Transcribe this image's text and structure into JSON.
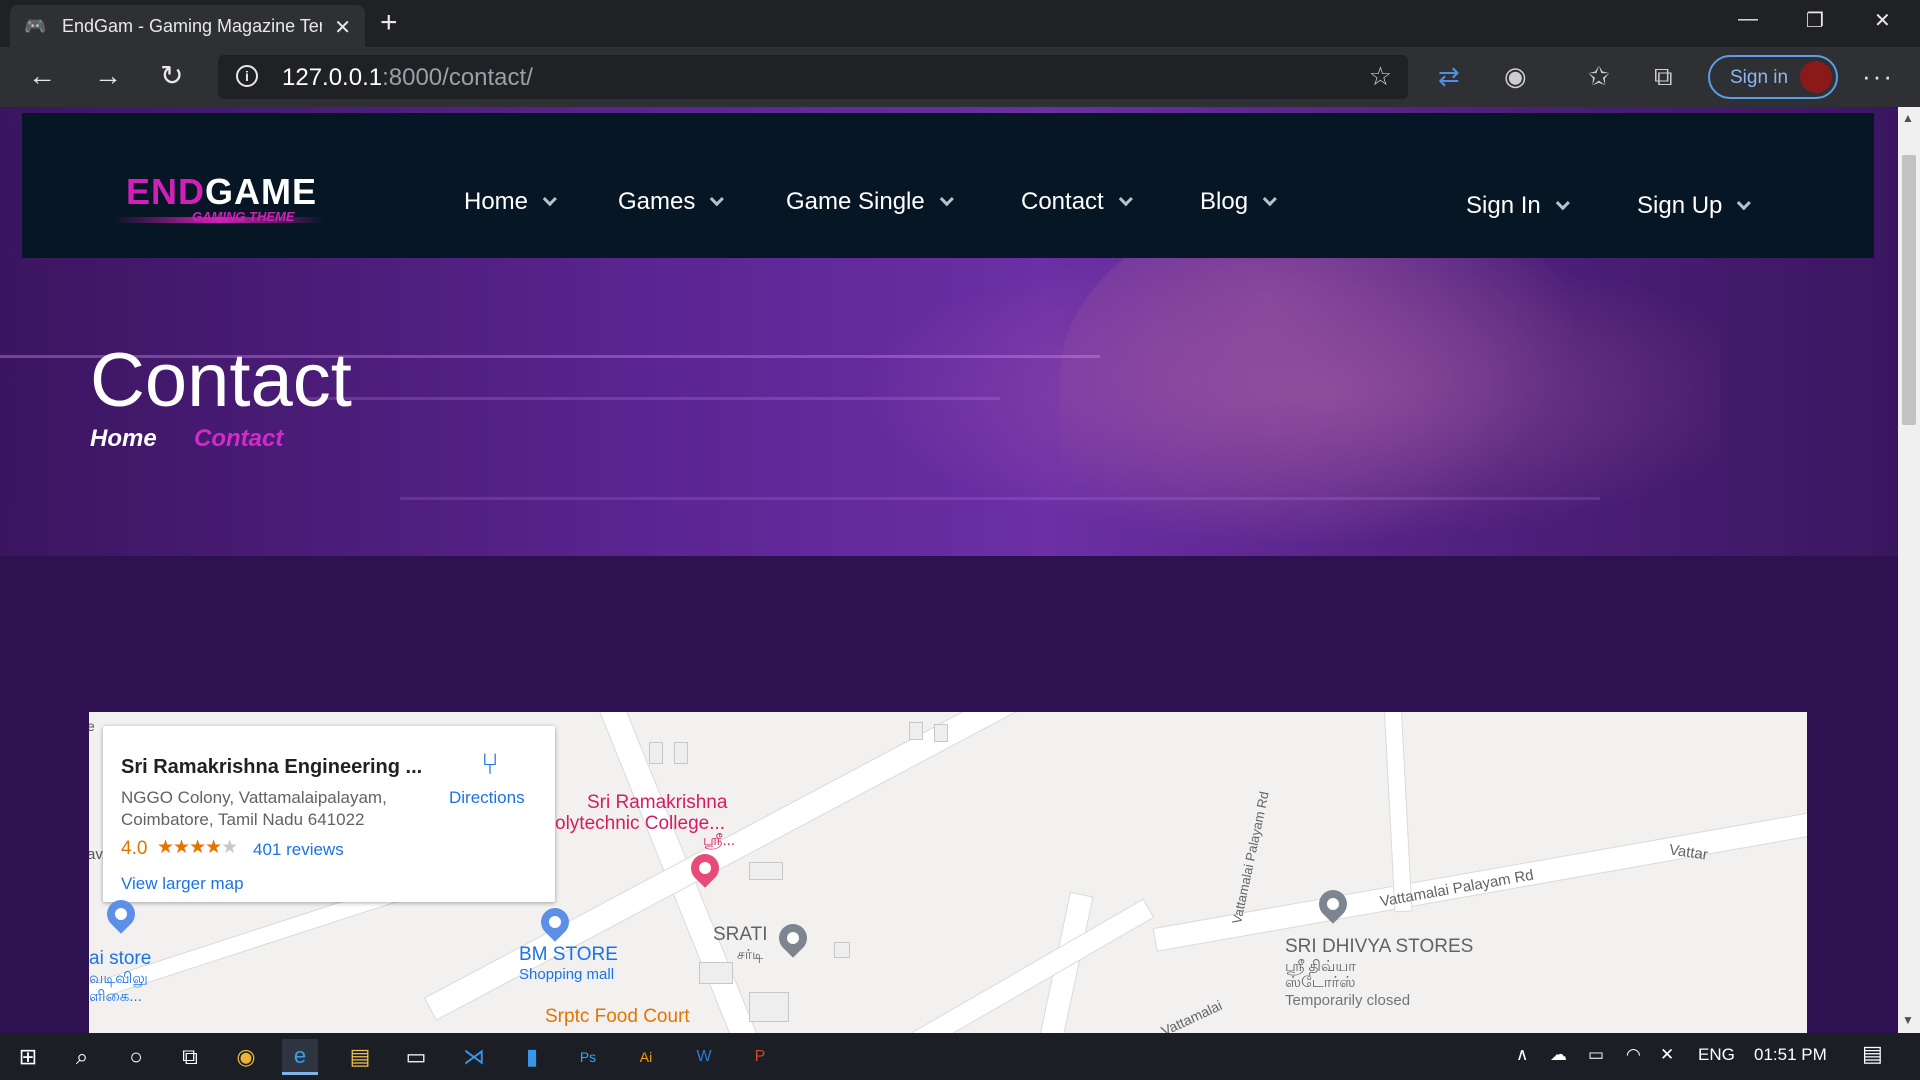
{
  "browser": {
    "tab_title": "EndGam - Gaming Magazine Ten",
    "tab_close": "✕",
    "new_tab": "+",
    "url_host": "127.0.0.1",
    "url_path": ":8000/contact/",
    "profile_label": "Sign in",
    "more": "···",
    "window_controls": {
      "minimize": "—",
      "restore": "❐",
      "close": "✕"
    }
  },
  "site": {
    "logo_end": "END",
    "logo_game": "GAME",
    "logo_sub": "GAMING THEME",
    "nav": [
      "Home",
      "Games",
      "Game Single",
      "Contact",
      "Blog"
    ],
    "auth": [
      "Sign In",
      "Sign Up"
    ]
  },
  "hero": {
    "title": "Contact",
    "breadcrumb_home": "Home",
    "breadcrumb_current": "Contact"
  },
  "map": {
    "place_name": "Sri Ramakrishna Engineering ...",
    "address_line1": "NGGO Colony, Vattamalaipalayam,",
    "address_line2": "Coimbatore, Tamil Nadu 641022",
    "rating": "4.0",
    "stars": "★★★★",
    "star_off": "★",
    "reviews": "401 reviews",
    "larger_map": "View larger map",
    "directions": "Directions",
    "labels": {
      "college_1": "Sri Ramakrishna",
      "college_2": "olytechnic College...",
      "college_3": "ஸ்ரீ...",
      "bm_store": "BM STORE",
      "bm_store_type": "Shopping mall",
      "srati": "SRATI",
      "srati_tamil": "சர்டி",
      "food_court": "Srptc Food Court",
      "store_left_1": "ai store",
      "store_left_2": "வடிவிலு",
      "store_left_3": "ளிகை...",
      "dhivya": "SRI DHIVYA STORES",
      "dhivya_tamil_1": "ஸ்ரீ திவ்யா",
      "dhivya_tamil_2": "ஸ்டோர்ஸ்",
      "dhivya_status": "Temporarily closed",
      "road_main": "Vattamalai Palayam Rd",
      "road_vert": "Vattamalai Palayam Rd",
      "road_right": "Vattar",
      "road_bottom": "Vattamalai",
      "edge_e": "e",
      "edge_av": "av"
    }
  },
  "taskbar": {
    "lang": "ENG",
    "time": "01:51 PM"
  },
  "colors": {
    "accent": "#d020b8",
    "header_bg": "#071624",
    "page_bg": "#2e1150",
    "link_blue": "#1a73e8"
  }
}
